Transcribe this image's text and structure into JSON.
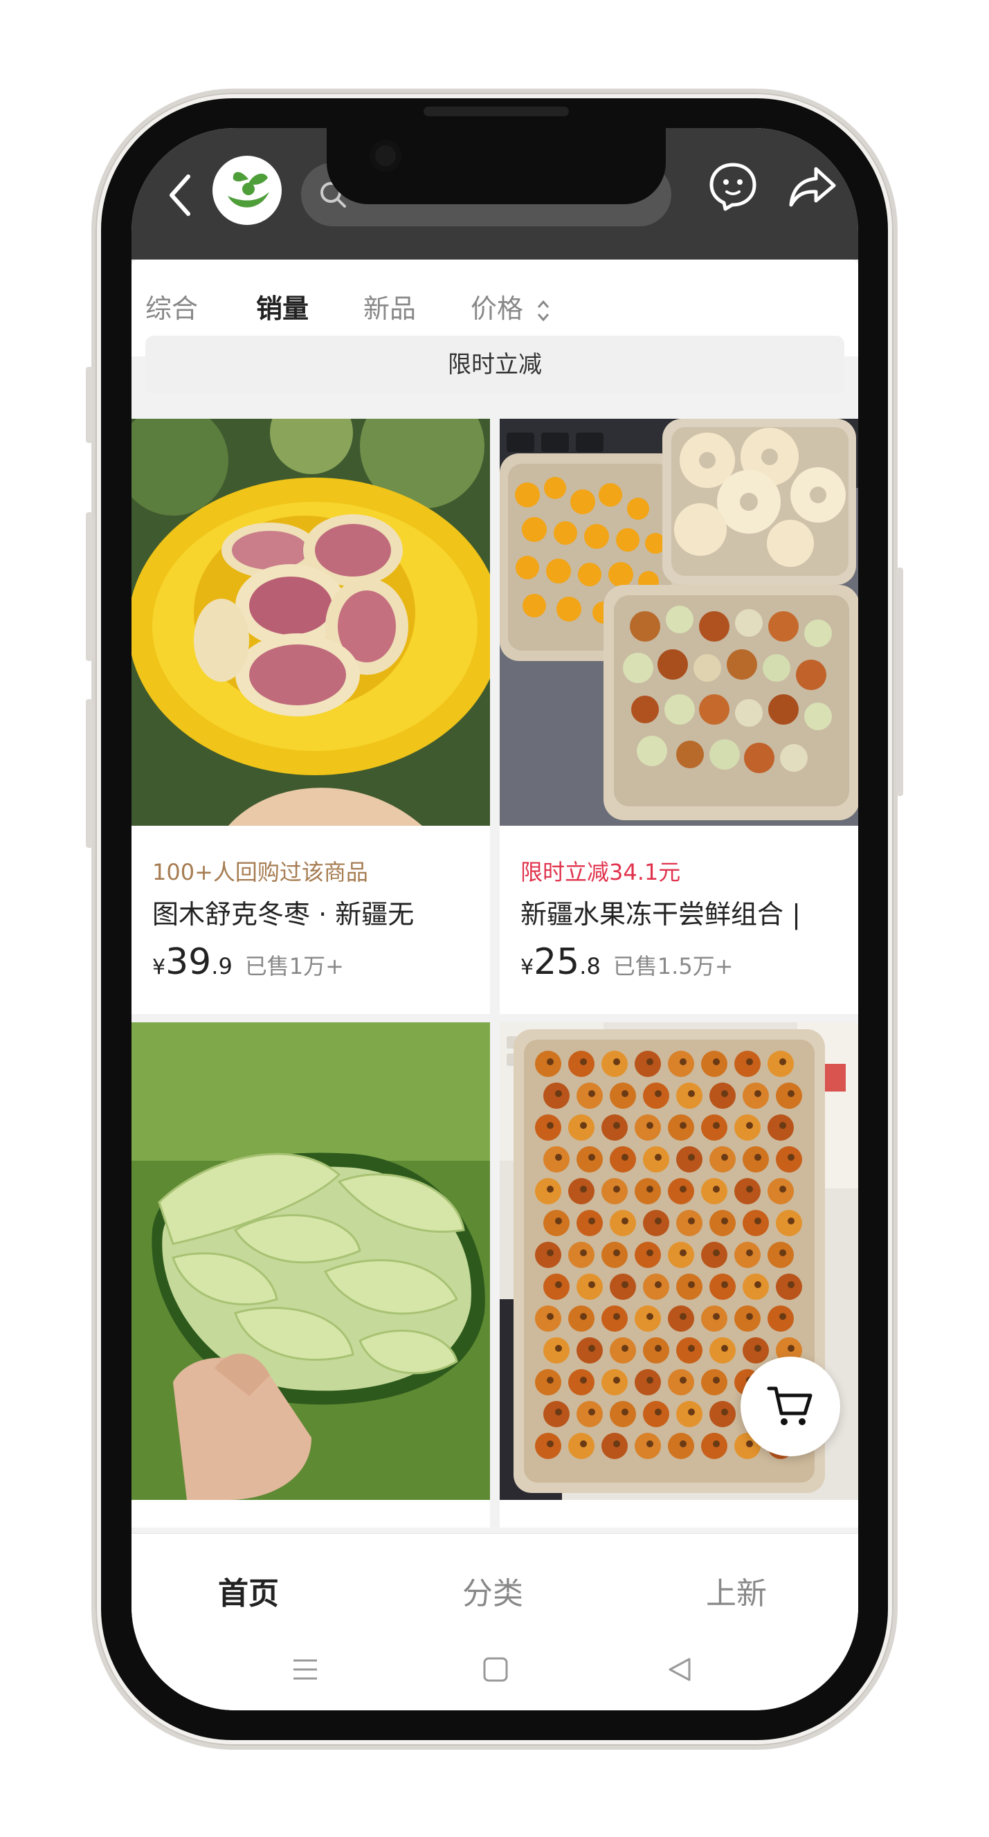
{
  "tabs": [
    {
      "label": "综合"
    },
    {
      "label": "销量"
    },
    {
      "label": "新品"
    },
    {
      "label": "价格"
    }
  ],
  "active_tab": "销量",
  "promo_bar": "限时立减",
  "products": [
    {
      "promo": "100+人回购过该商品",
      "promo_color": "#a67c52",
      "title": "图木舒克冬枣 · 新疆无",
      "price_yen": "¥",
      "price_int": "39",
      "price_dec": ".9",
      "sold": "已售1万+"
    },
    {
      "promo": "限时立减34.1元",
      "promo_color": "#e0324c",
      "title": "新疆水果冻干尝鲜组合 |",
      "price_yen": "¥",
      "price_int": "25",
      "price_dec": ".8",
      "sold": "已售1.5万+"
    }
  ],
  "bottom_nav": [
    {
      "label": "首页"
    },
    {
      "label": "分类"
    },
    {
      "label": "上新"
    }
  ],
  "active_nav": "首页",
  "colors": {
    "header_bg": "#3a3a3a",
    "promo_red": "#e0324c",
    "promo_brown": "#a67c52",
    "logo_green": "#4e9e3a"
  }
}
